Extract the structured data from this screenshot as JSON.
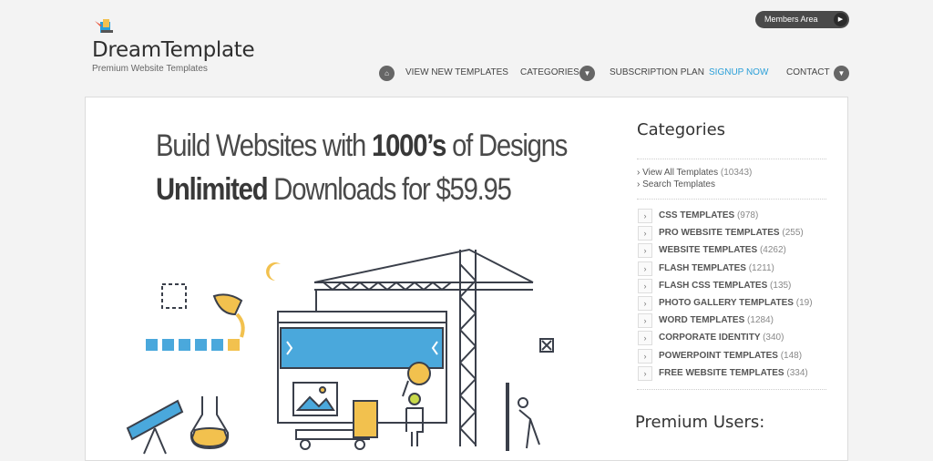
{
  "header": {
    "brand": "DreamTemplate",
    "tagline": "Premium Website Templates",
    "members_label": "Members Area",
    "members_icon": "play-icon"
  },
  "nav": {
    "home_icon": "home-icon",
    "items": [
      {
        "label": "VIEW NEW TEMPLATES"
      },
      {
        "label": "CATEGORIES"
      },
      {
        "label": "SUBSCRIPTION PLAN"
      },
      {
        "label": "SIGNUP NOW",
        "active": true
      },
      {
        "label": "CONTACT"
      }
    ],
    "accent_color": "#2a9fd8"
  },
  "hero": {
    "line1_a": "Build Websites with ",
    "line1_b": "1000’s",
    "line1_c": " of Designs",
    "line2_a": "Unlimited",
    "line2_b": " Downloads for $59.95"
  },
  "sidebar": {
    "title": "Categories",
    "links": [
      {
        "label": "View All Templates",
        "count": "(10343)"
      },
      {
        "label": "Search Templates",
        "count": ""
      }
    ],
    "categories": [
      {
        "label": "CSS TEMPLATES",
        "count": "(978)"
      },
      {
        "label": "PRO WEBSITE TEMPLATES",
        "count": "(255)"
      },
      {
        "label": "WEBSITE TEMPLATES",
        "count": "(4262)"
      },
      {
        "label": "FLASH TEMPLATES",
        "count": "(1211)"
      },
      {
        "label": "FLASH CSS TEMPLATES",
        "count": "(135)"
      },
      {
        "label": "PHOTO GALLERY TEMPLATES",
        "count": "(19)"
      },
      {
        "label": "WORD TEMPLATES",
        "count": "(1284)"
      },
      {
        "label": "CORPORATE IDENTITY",
        "count": "(340)"
      },
      {
        "label": "POWERPOINT TEMPLATES",
        "count": "(148)"
      },
      {
        "label": "FREE WEBSITE TEMPLATES",
        "count": "(334)"
      }
    ],
    "premium_title": "Premium Users:"
  }
}
